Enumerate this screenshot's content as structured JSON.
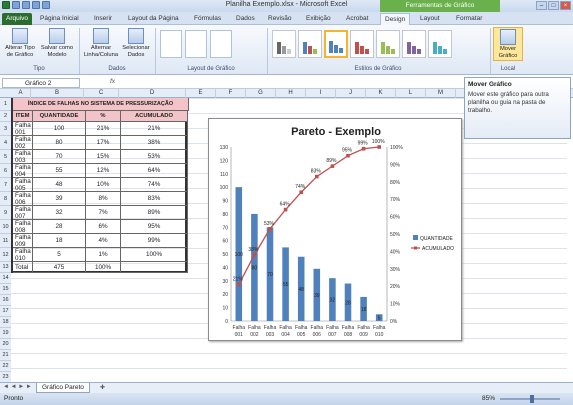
{
  "window": {
    "title": "Planilha Exemplo.xlsx - Microsoft Excel",
    "context_tab_title": "Ferramentas de Gráfico"
  },
  "tabs": [
    "Arquivo",
    "Página Inicial",
    "Inserir",
    "Layout da Página",
    "Fórmulas",
    "Dados",
    "Revisão",
    "Exibição",
    "Acrobat",
    "Design",
    "Layout",
    "Formatar"
  ],
  "ribbon": {
    "btn_tipo": "Alterar Tipo de Gráfico",
    "btn_salvar": "Salvar como Modelo",
    "grp_tipo": "Tipo",
    "btn_alternar": "Alternar Linha/Coluna",
    "btn_selecionar": "Selecionar Dados",
    "grp_dados": "Dados",
    "grp_layout": "Layout de Gráfico",
    "grp_estilos": "Estilos de Gráfico",
    "btn_mover": "Mover Gráfico",
    "grp_local": "Local"
  },
  "formula": {
    "namebox": "Gráfico 2",
    "fx": "fx"
  },
  "tooltip": {
    "title": "Mover Gráfico",
    "body": "Mover este gráfico para outra planilha ou guia na pasta de trabalho."
  },
  "columns": [
    "A",
    "B",
    "C",
    "D",
    "E",
    "F",
    "G",
    "H",
    "I",
    "J",
    "K",
    "L",
    "M"
  ],
  "rows": [
    "1",
    "2",
    "3",
    "4",
    "5",
    "6",
    "7",
    "8",
    "9",
    "10",
    "11",
    "12",
    "13",
    "14",
    "15",
    "16",
    "17",
    "18",
    "19",
    "20",
    "21",
    "22",
    "23"
  ],
  "table": {
    "title": "ÍNDICE DE FALHAS NO SISTEMA DE PRESSURIZAÇÃO",
    "headers": [
      "ITEM",
      "QUANTIDADE",
      "%",
      "ACUMULADO"
    ],
    "rows": [
      [
        "Falha 001",
        "100",
        "21%",
        "21%"
      ],
      [
        "Falha 002",
        "80",
        "17%",
        "38%"
      ],
      [
        "Falha 003",
        "70",
        "15%",
        "53%"
      ],
      [
        "Falha 004",
        "55",
        "12%",
        "64%"
      ],
      [
        "Falha 005",
        "48",
        "10%",
        "74%"
      ],
      [
        "Falha 006",
        "39",
        "8%",
        "83%"
      ],
      [
        "Falha 007",
        "32",
        "7%",
        "89%"
      ],
      [
        "Falha 008",
        "28",
        "6%",
        "95%"
      ],
      [
        "Falha 009",
        "18",
        "4%",
        "99%"
      ],
      [
        "Falha 010",
        "5",
        "1%",
        "100%"
      ]
    ],
    "total": [
      "Total",
      "475",
      "100%",
      ""
    ]
  },
  "chart_data": {
    "type": "bar",
    "title": "Pareto - Exemplo",
    "categories": [
      "Falha 001",
      "Falha 002",
      "Falha 003",
      "Falha 004",
      "Falha 005",
      "Falha 006",
      "Falha 007",
      "Falha 008",
      "Falha 009",
      "Falha 010"
    ],
    "series": [
      {
        "name": "QUANTIDADE",
        "type": "bar",
        "axis": "left",
        "values": [
          100,
          80,
          70,
          55,
          48,
          39,
          32,
          28,
          18,
          5
        ],
        "color": "#4f81bd"
      },
      {
        "name": "ACUMULADO",
        "type": "line",
        "axis": "right",
        "values": [
          21,
          38,
          53,
          64,
          74,
          83,
          89,
          95,
          99,
          100
        ],
        "color": "#c0504d"
      }
    ],
    "bar_labels": [
      "100",
      "80",
      "70",
      "55",
      "48",
      "39",
      "32",
      "28",
      "18",
      "5"
    ],
    "line_labels": [
      "21%",
      "38%",
      "53%",
      "64%",
      "74%",
      "83%",
      "89%",
      "95%",
      "99%",
      "100%"
    ],
    "ylim": [
      0,
      130
    ],
    "y_ticks": [
      "0",
      "10",
      "20",
      "30",
      "40",
      "50",
      "60",
      "70",
      "80",
      "90",
      "100",
      "110",
      "120",
      "130"
    ],
    "y2lim": [
      0,
      100
    ],
    "y2_ticks": [
      "0%",
      "10%",
      "20%",
      "30%",
      "40%",
      "50%",
      "60%",
      "70%",
      "80%",
      "90%",
      "100%"
    ],
    "legend": "right",
    "grid": false
  },
  "sheet_tab": "Gráfico Pareto",
  "status": {
    "left": "Pronto",
    "zoom": "85%"
  },
  "colors": {
    "accent": "#2a6e2f",
    "table_header": "#f2c4c7",
    "bar": "#4f81bd",
    "line": "#c0504d"
  }
}
